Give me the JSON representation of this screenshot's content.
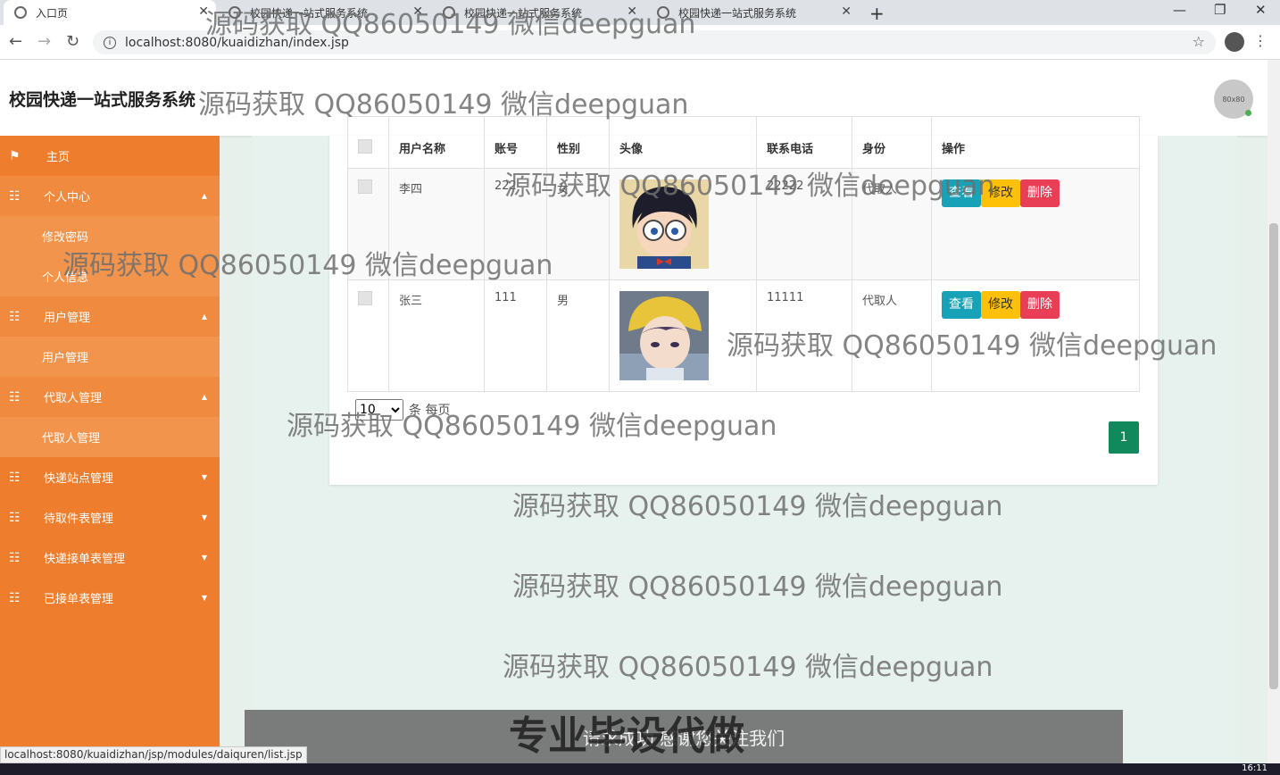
{
  "browser": {
    "tabs": [
      {
        "title": "入口页"
      },
      {
        "title": "校园快递一站式服务系统"
      },
      {
        "title": "校园快递一站式服务系统"
      },
      {
        "title": "校园快递一站式服务系统"
      }
    ],
    "url": "localhost:8080/kuaidizhan/index.jsp",
    "status_url": "localhost:8080/kuaidizhan/jsp/modules/daiquren/list.jsp"
  },
  "header": {
    "title": "校园快递一站式服务系统",
    "avatar_text": "80x80"
  },
  "sidebar": {
    "home": "主页",
    "personal_center": "个人中心",
    "change_password": "修改密码",
    "personal_info": "个人信息",
    "user_mgmt": "用户管理",
    "user_mgmt_sub": "用户管理",
    "agent_mgmt": "代取人管理",
    "agent_mgmt_sub": "代取人管理",
    "station_mgmt": "快递站点管理",
    "pending_mgmt": "待取件表管理",
    "order_mgmt": "快递接单表管理",
    "accepted_mgmt": "已接单表管理"
  },
  "table": {
    "headers": [
      "用户名称",
      "账号",
      "性别",
      "头像",
      "联系电话",
      "身份",
      "操作"
    ],
    "rows": [
      {
        "name": "李四",
        "account": "222",
        "gender": "女",
        "phone": "22222",
        "role": "代取人"
      },
      {
        "name": "张三",
        "account": "111",
        "gender": "男",
        "phone": "11111",
        "role": "代取人"
      }
    ],
    "actions": {
      "view": "查看",
      "edit": "修改",
      "delete": "删除"
    }
  },
  "pager": {
    "page_size": "10",
    "per_page_label": "条 每页",
    "current_page": "1"
  },
  "toast": "请求成功 感谢您关注我们",
  "taskbar_time": "16:11",
  "watermark": "源码获取 QQ86050149 微信deepguan",
  "watermark_big": "专业毕设代做",
  "colors": {
    "sidebar": "#ee7d2e",
    "view_button": "#17a2b8",
    "edit_button": "#ffc107",
    "delete_button": "#e83e56",
    "pager_active": "#12885d"
  }
}
